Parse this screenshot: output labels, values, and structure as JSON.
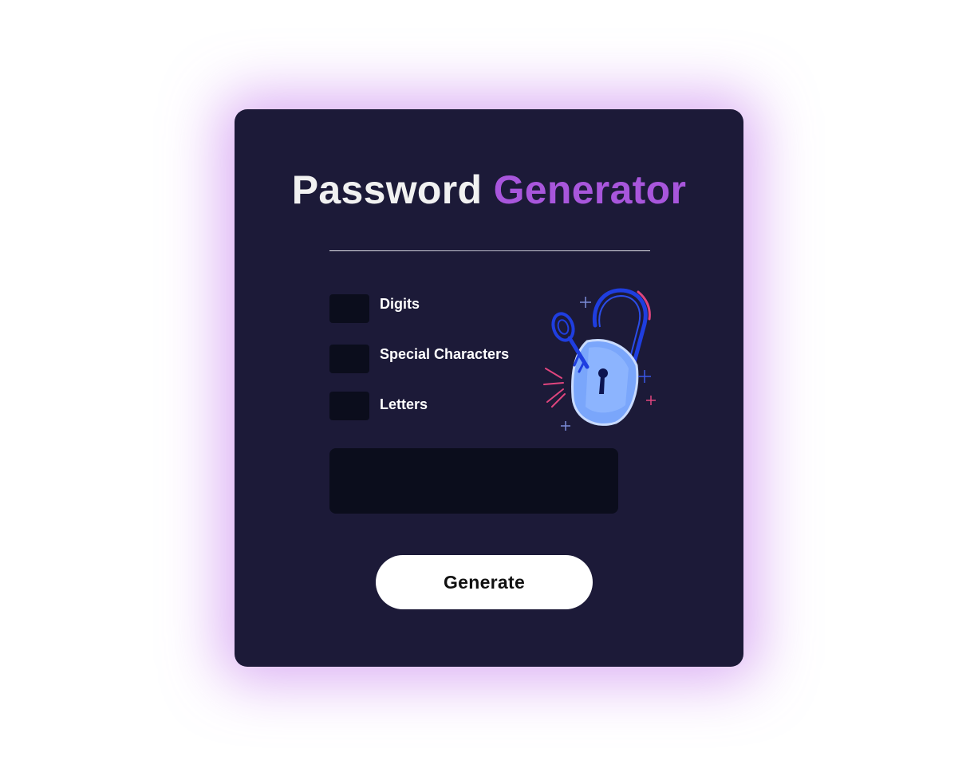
{
  "title": {
    "word1": "Password",
    "word2": "Generator",
    "word1_color": "#f1f1f1",
    "word2_color": "#a856dc"
  },
  "options": [
    {
      "label": "Digits",
      "checked": false
    },
    {
      "label": "Special Characters",
      "checked": false
    },
    {
      "label": "Letters",
      "checked": false
    }
  ],
  "output": {
    "value": "",
    "placeholder": ""
  },
  "generate_button": {
    "label": "Generate"
  },
  "illustration": {
    "icon": "unlocked-padlock-with-key-icon"
  },
  "colors": {
    "card_background": "#1c1a38",
    "card_glow": "#be6eeb",
    "field_background": "#0b0d1c",
    "accent": "#a856dc"
  }
}
